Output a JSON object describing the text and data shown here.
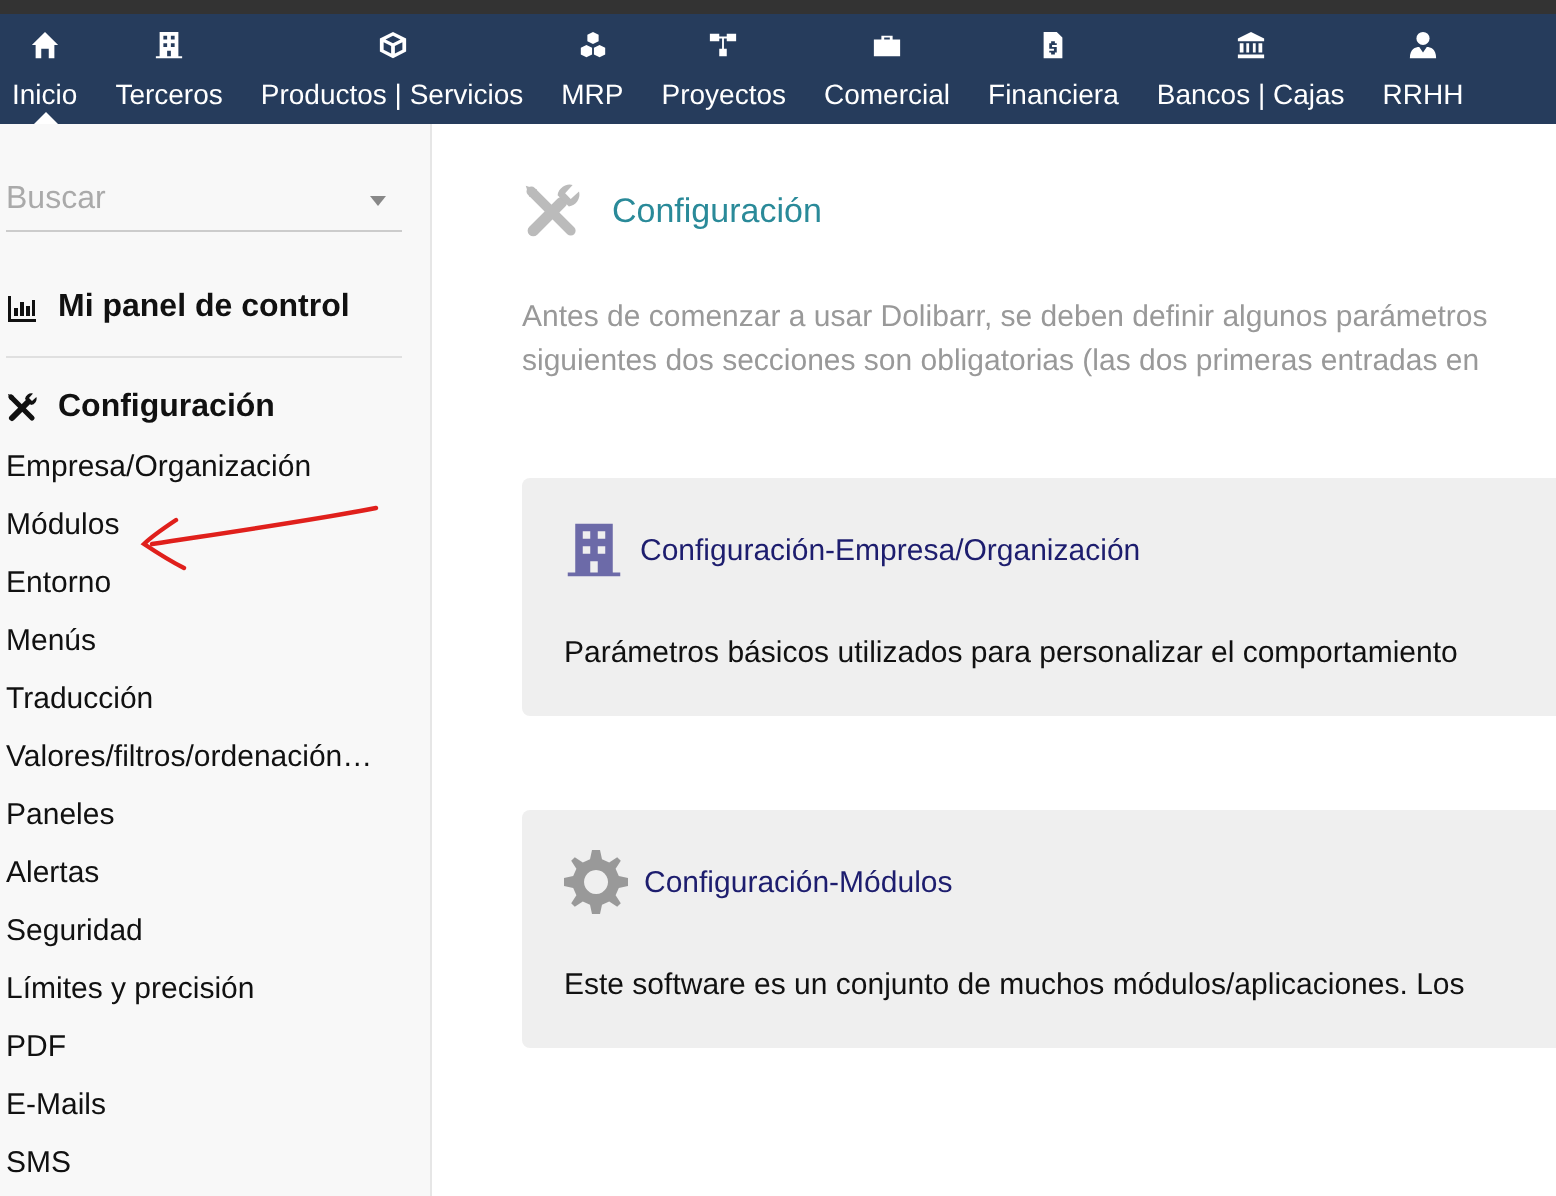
{
  "top_menu": [
    {
      "label": "Inicio",
      "selected": true
    },
    {
      "label": "Terceros",
      "selected": false
    },
    {
      "label": "Productos | Servicios",
      "selected": false
    },
    {
      "label": "MRP",
      "selected": false
    },
    {
      "label": "Proyectos",
      "selected": false
    },
    {
      "label": "Comercial",
      "selected": false
    },
    {
      "label": "Financiera",
      "selected": false
    },
    {
      "label": "Bancos | Cajas",
      "selected": false
    },
    {
      "label": "RRHH",
      "selected": false
    }
  ],
  "sidebar": {
    "search": {
      "placeholder": "Buscar"
    },
    "sections": [
      {
        "title": "Mi panel de control"
      },
      {
        "title": "Configuración",
        "items": [
          "Empresa/Organización",
          "Módulos",
          "Entorno",
          "Menús",
          "Traducción",
          "Valores/filtros/ordenación…",
          "Paneles",
          "Alertas",
          "Seguridad",
          "Límites y precisión",
          "PDF",
          "E-Mails",
          "SMS"
        ]
      }
    ]
  },
  "main": {
    "title": "Configuración",
    "intro": [
      "Antes de comenzar a usar Dolibarr, se deben definir algunos parámetros",
      "siguientes dos secciones son obligatorias (las dos primeras entradas en"
    ],
    "cards": [
      {
        "title": "Configuración-Empresa/Organización",
        "text": "Parámetros básicos utilizados para personalizar el comportamiento"
      },
      {
        "title": "Configuración-Módulos",
        "text": "Este software es un conjunto de muchos módulos/aplicaciones. Los"
      }
    ]
  }
}
